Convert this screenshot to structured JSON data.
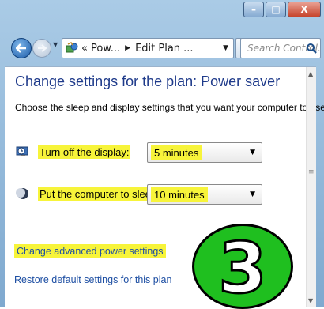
{
  "window": {
    "minimize_glyph": "–",
    "maximize_glyph": "□",
    "close_glyph": "X"
  },
  "nav": {
    "back_icon": "back-arrow",
    "forward_icon": "forward-arrow",
    "address": {
      "prefix": "«",
      "crumb1": "Pow...",
      "crumb2": "Edit Plan ..."
    },
    "search_placeholder": "Search Control..."
  },
  "page": {
    "title": "Change settings for the plan: Power saver",
    "description": "Choose the sleep and display settings that you want your computer to use.",
    "display_label": "Turn off the display:",
    "display_value": "5 minutes",
    "sleep_label": "Put the computer to sleep:",
    "sleep_value": "10 minutes",
    "advanced_link": "Change advanced power settings",
    "restore_link": "Restore default settings for this plan"
  },
  "badge": {
    "number": "3",
    "color": "#1fbf1f"
  },
  "colors": {
    "highlight": "#f7f43a",
    "title": "#1e3a8a",
    "link": "#1e4fa3"
  }
}
